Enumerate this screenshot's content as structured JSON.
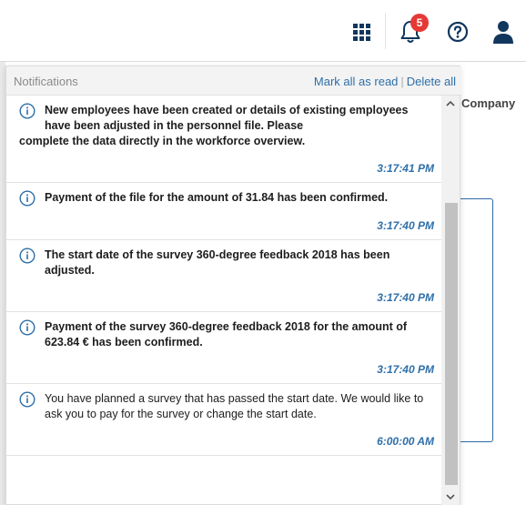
{
  "topbar": {
    "notification_count": "5",
    "icons": [
      "apps-grid-icon",
      "bell-icon",
      "help-icon",
      "user-icon"
    ],
    "accent": "#11375d",
    "badge_color": "#e53935"
  },
  "background": {
    "company_label": "Company"
  },
  "notifications": {
    "title": "Notifications",
    "mark_all_read": "Mark all as read",
    "separator": "|",
    "delete_all": "Delete all",
    "link_color": "#2e6fa9",
    "items": [
      {
        "text_a": "New employees have been created or details of existing employees have been adjusted in the personnel file. Please",
        "text_b": "complete the data directly in the workforce overview.",
        "time": "3:17:41 PM"
      },
      {
        "text": "Payment of the file for the amount of 31.84 has been confirmed.",
        "time": "3:17:40 PM"
      },
      {
        "text": "The start date of the survey 360-degree feedback 2018 has been adjusted.",
        "time": "3:17:40 PM"
      },
      {
        "text": "Payment of the survey 360-degree feedback 2018 for the amount of 623.84 € has been confirmed.",
        "time": "3:17:40 PM"
      },
      {
        "text": "You have planned a survey that has passed the start date. We would like to ask you to pay for the survey or change the start date.",
        "time": "6:00:00 AM"
      }
    ]
  }
}
